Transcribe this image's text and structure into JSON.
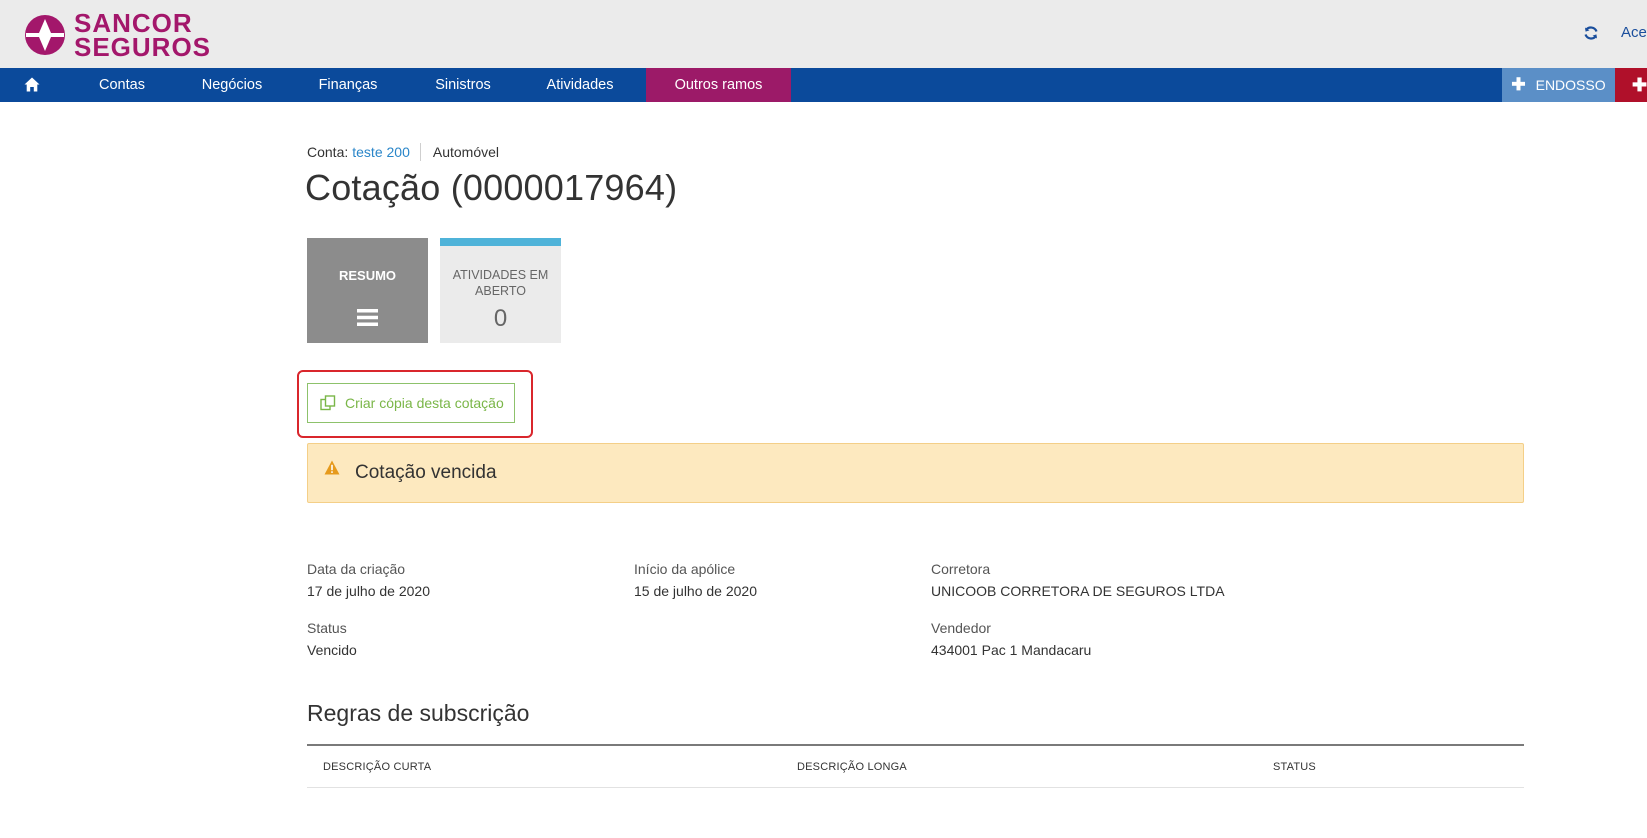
{
  "header": {
    "brand_line1": "SANCOR",
    "brand_line2": "SEGUROS",
    "refresh_icon": "refresh-icon",
    "access_label": "Acesso"
  },
  "nav": {
    "home_icon": "home-icon",
    "items": [
      "Contas",
      "Negócios",
      "Finanças",
      "Sinistros",
      "Atividades",
      "Outros ramos"
    ],
    "endosso_label": "ENDOSSO",
    "plus_label": "✚"
  },
  "breadcrumb": {
    "account_prefix": "Conta:",
    "account_name": "teste 200",
    "product": "Automóvel"
  },
  "page_title": "Cotação (0000017964)",
  "tiles": {
    "resumo_label": "RESUMO",
    "atividades_label": "ATIVIDADES EM ABERTO",
    "atividades_count": "0"
  },
  "actions": {
    "copy_label": "Criar cópia desta cotação"
  },
  "alert": {
    "icon": "warning-icon",
    "text": "Cotação vencida"
  },
  "details": {
    "creation_label": "Data da criação",
    "creation_value": "17 de julho de 2020",
    "start_label": "Início da apólice",
    "start_value": "15 de julho de 2020",
    "broker_label": "Corretora",
    "broker_value": "UNICOOB CORRETORA DE SEGUROS LTDA",
    "status_label": "Status",
    "status_value": "Vencido",
    "seller_label": "Vendedor",
    "seller_value": "434001 Pac 1 Mandacaru"
  },
  "rules": {
    "title": "Regras de subscrição",
    "columns": [
      "DESCRIÇÃO CURTA",
      "DESCRIÇÃO LONGA",
      "STATUS"
    ]
  },
  "colors": {
    "brand": "#a3176b",
    "nav": "#0b4a9b",
    "nav_active": "#9c1a68",
    "alert_bg": "#fde9bf",
    "copy_green": "#7ab648"
  }
}
